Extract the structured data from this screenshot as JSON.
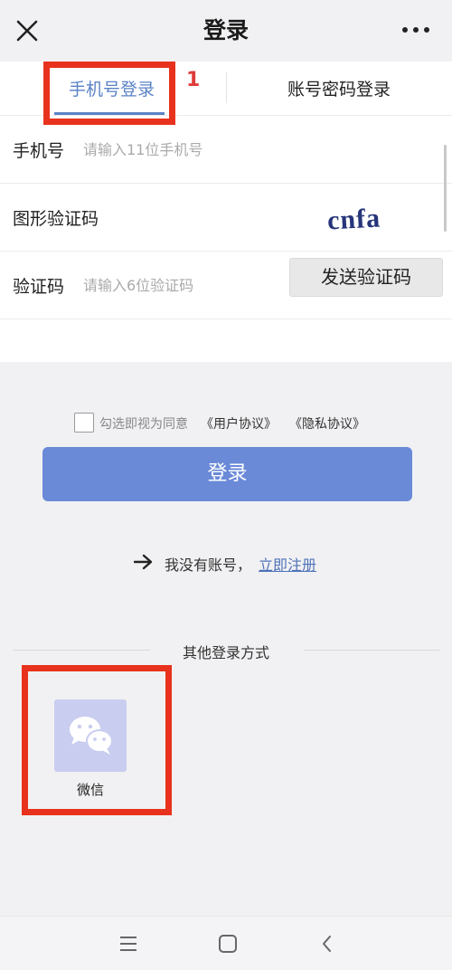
{
  "header": {
    "title": "登录",
    "close_icon": "close-icon",
    "more_icon": "more-dots-icon"
  },
  "tabs": [
    {
      "label": "手机号登录",
      "active": true
    },
    {
      "label": "账号密码登录",
      "active": false
    }
  ],
  "form": {
    "phone": {
      "label": "手机号",
      "placeholder": "请输入11位手机号",
      "value": ""
    },
    "captcha": {
      "label": "图形验证码",
      "image_text": "cnfa"
    },
    "code": {
      "label": "验证码",
      "placeholder": "请输入6位验证码",
      "value": "",
      "send_button": "发送验证码"
    }
  },
  "agreement": {
    "checked": false,
    "text": "勾选即视为同意",
    "user_agreement": "《用户协议》",
    "privacy_policy": "《隐私协议》"
  },
  "login_button": "登录",
  "register": {
    "text": "我没有账号，",
    "link": "立即注册"
  },
  "other_login": {
    "title": "其他登录方式",
    "options": [
      {
        "label": "微信",
        "icon": "wechat-icon"
      }
    ]
  },
  "annotations": {
    "marker_1": "1"
  },
  "colors": {
    "accent": "#5a82c6",
    "login_button": "#6a8ad8",
    "wechat_tile": "#c9cdf0",
    "annotation": "#e8321d"
  },
  "navbar": {
    "icons": [
      "menu-icon",
      "home-square-icon",
      "back-icon"
    ]
  }
}
